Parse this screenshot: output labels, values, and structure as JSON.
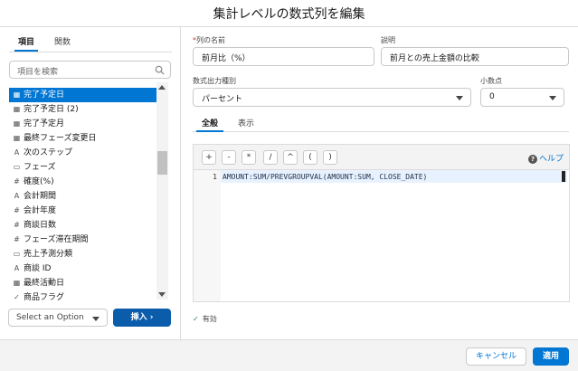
{
  "dialog": {
    "title": "集計レベルの数式列を編集"
  },
  "left_panel": {
    "tabs": [
      {
        "label": "項目",
        "active": true
      },
      {
        "label": "関数",
        "active": false
      }
    ],
    "search": {
      "placeholder": "項目を検索"
    },
    "items": [
      {
        "label": "完了予定日",
        "icon": "calendar-icon",
        "selected": true
      },
      {
        "label": "完了予定日 (2)",
        "icon": "calendar-icon",
        "selected": false
      },
      {
        "label": "完了予定月",
        "icon": "calendar-icon",
        "selected": false
      },
      {
        "label": "最終フェーズ変更日",
        "icon": "calendar-icon",
        "selected": false
      },
      {
        "label": "次のステップ",
        "icon": "text-icon",
        "selected": false
      },
      {
        "label": "フェーズ",
        "icon": "picklist-icon",
        "selected": false
      },
      {
        "label": "確度(%)",
        "icon": "number-icon",
        "selected": false
      },
      {
        "label": "会計期間",
        "icon": "text-icon",
        "selected": false
      },
      {
        "label": "会計年度",
        "icon": "number-icon",
        "selected": false
      },
      {
        "label": "商談日数",
        "icon": "number-icon",
        "selected": false
      },
      {
        "label": "フェーズ滞在期間",
        "icon": "number-icon",
        "selected": false
      },
      {
        "label": "売上予測分類",
        "icon": "picklist-icon",
        "selected": false
      },
      {
        "label": "商談 ID",
        "icon": "text-icon",
        "selected": false
      },
      {
        "label": "最終活動日",
        "icon": "calendar-icon",
        "selected": false
      },
      {
        "label": "商品フラグ",
        "icon": "checkbox-icon",
        "selected": false
      }
    ],
    "select_option": "Select an Option",
    "insert_button": "挿入 ›"
  },
  "form": {
    "column_name_label": "列の名前",
    "column_name_value": "前月比（%）",
    "description_label": "説明",
    "description_value": "前月との売上金額の比較",
    "output_type_label": "数式出力種別",
    "output_type_value": "パーセント",
    "decimal_label": "小数点",
    "decimal_value": "0",
    "tabs": [
      {
        "label": "全般",
        "active": true
      },
      {
        "label": "表示",
        "active": false
      }
    ]
  },
  "editor": {
    "operators": [
      "+",
      "-",
      "*",
      "/",
      "^",
      "(",
      ")"
    ],
    "help_label": "ヘルプ",
    "line_number": "1",
    "formula": "AMOUNT:SUM/PREVGROUPVAL(AMOUNT:SUM, CLOSE_DATE)"
  },
  "validation": {
    "text": "有効"
  },
  "footer": {
    "cancel_label": "キャンセル",
    "apply_label": "適用"
  },
  "colors": {
    "accent": "#0176d3",
    "insert_button": "#0b5cab",
    "valid": "#2e844a"
  }
}
